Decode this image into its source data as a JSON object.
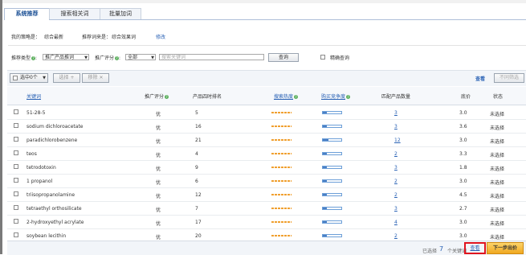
{
  "tabs": [
    {
      "label": "系统推荐"
    },
    {
      "label": "搜索相关词"
    },
    {
      "label": "批量加词"
    }
  ],
  "summary": {
    "keyword_type_label": "我的策略是：",
    "keyword_type_value": "综合最新",
    "effect_label": "推荐词来是：",
    "effect_value": "综合效果词",
    "modify_link": "修改"
  },
  "filters": {
    "type_label": "推荐类型",
    "type_value": "推广产品推词",
    "score_label": "推广评分",
    "score_value": "全部",
    "search_placeholder": "搜索关键词",
    "query_button": "查询",
    "exact_label": "精确查询"
  },
  "toolbar": {
    "selected_count": "选中0个",
    "select_button": "选择",
    "remove_button": "移除",
    "view_link": "查看",
    "disabled_button": "不同筛选"
  },
  "table": {
    "headers": {
      "keyword": "关键词",
      "score": "推广评分",
      "rank": "产品四时排名",
      "heat": "搜索热度",
      "competition": "购买竞争度",
      "matched_products": "匹配产品数量",
      "bid": "底价",
      "status": "状态"
    },
    "rows": [
      {
        "keyword": "51-28-5",
        "score": "优",
        "rank": "5",
        "heat": 0.6,
        "competition": 0.2,
        "matched": "3",
        "bid": "3.0",
        "status": "未选择"
      },
      {
        "keyword": "sodium dichloroacetate",
        "score": "优",
        "rank": "16",
        "heat": 0.6,
        "competition": 0.2,
        "matched": "3",
        "bid": "3.6",
        "status": "未选择"
      },
      {
        "keyword": "paradichlorobenzene",
        "score": "优",
        "rank": "21",
        "heat": 0.6,
        "competition": 0.3,
        "matched": "12",
        "bid": "3.0",
        "status": "未选择"
      },
      {
        "keyword": "teos",
        "score": "优",
        "rank": "4",
        "heat": 0.6,
        "competition": 0.2,
        "matched": "2",
        "bid": "3.3",
        "status": "未选择"
      },
      {
        "keyword": "tetrodotoxin",
        "score": "优",
        "rank": "9",
        "heat": 0.6,
        "competition": 0.2,
        "matched": "3",
        "bid": "1.8",
        "status": "未选择"
      },
      {
        "keyword": "1 propanol",
        "score": "优",
        "rank": "6",
        "heat": 0.6,
        "competition": 0.2,
        "matched": "2",
        "bid": "3.0",
        "status": "未选择"
      },
      {
        "keyword": "triisopropanolamine",
        "score": "优",
        "rank": "12",
        "heat": 0.6,
        "competition": 0.2,
        "matched": "2",
        "bid": "4.5",
        "status": "未选择"
      },
      {
        "keyword": "tetraethyl orthosilicate",
        "score": "优",
        "rank": "7",
        "heat": 0.6,
        "competition": 0.2,
        "matched": "3",
        "bid": "2.7",
        "status": "未选择"
      },
      {
        "keyword": "2-hydroxyethyl acrylate",
        "score": "优",
        "rank": "17",
        "heat": 0.6,
        "competition": 0.2,
        "matched": "4",
        "bid": "3.0",
        "status": "未选择"
      },
      {
        "keyword": "soybean lecithin",
        "score": "优",
        "rank": "20",
        "heat": 0.6,
        "competition": 0.2,
        "matched": "2",
        "bid": "3.0",
        "status": "未选择"
      }
    ]
  },
  "footer": {
    "selected_prefix": "已选择",
    "selected_count": "7",
    "selected_suffix": "个关键词",
    "view_link": "查看",
    "next_button": "下一步出价"
  },
  "colors": {
    "accent": "#2a62b5",
    "heat": "#f0a030",
    "competition": "#4a7fc5",
    "next_button": "#f6b830",
    "highlight": "#e0141e"
  }
}
